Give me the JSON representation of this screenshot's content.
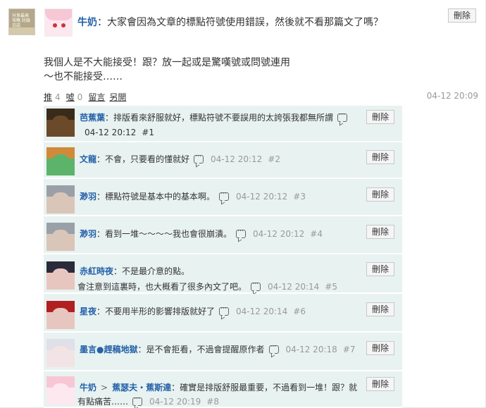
{
  "post": {
    "author": "牛奶",
    "colon": "：",
    "title": "大家會因為文章的標點符號使用錯誤，然後就不看那篇文了嗎？",
    "delete_label": "刪除",
    "avatar_text": "分享最高 攻略 討論 日誌",
    "body": [
      "我個人是不大能接受！跟？放一起或是驚嘆號或問號連用",
      "～也不能接受……"
    ],
    "actions": {
      "push_label": "推",
      "push_count": "4",
      "boo_label": "噓",
      "boo_count": "0",
      "reply_label": "留言",
      "other_label": "另開"
    },
    "time": "04-12 20:09"
  },
  "comments": [
    {
      "name": "芭蕉葉",
      "text": "：排版看來舒服就好，標點符號不要誤用的太誇張我都無所謂",
      "time": "04-12 20:12",
      "no": "#1",
      "delete_label": "刪除",
      "avatar_color": "#6b4a2a",
      "hair_color": "#3a2a1a"
    },
    {
      "name": "文龍",
      "text": "：不會，只要看的懂就好",
      "time": "04-12 20:12",
      "no": "#2",
      "delete_label": "刪除",
      "avatar_color": "#5bb46a",
      "hair_color": "#d08a3a"
    },
    {
      "name": "渺羽",
      "text": "：標點符號是基本中的基本啊。",
      "time": "04-12 20:12",
      "no": "#3",
      "delete_label": "刪除",
      "avatar_color": "#d9c6b8",
      "hair_color": "#9aa0a8"
    },
    {
      "name": "渺羽",
      "text": "：看到一堆～～～～我也會很崩潰。",
      "time": "04-12 20:12",
      "no": "#4",
      "delete_label": "刪除",
      "avatar_color": "#d9c6b8",
      "hair_color": "#9aa0a8"
    },
    {
      "name": "赤紅時夜",
      "text": "：不是最介意的點。",
      "text2": "會注意到這裏時，也大概看了很多內文了吧。",
      "time": "04-12 20:14",
      "no": "#5",
      "delete_label": "刪除",
      "avatar_color": "#e8c6c0",
      "hair_color": "#2a2a3a"
    },
    {
      "name": "星夜",
      "text": "：不要用半形的影響排版就好了",
      "time": "04-12 20:14",
      "no": "#6",
      "delete_label": "刪除",
      "avatar_color": "#e8c6c0",
      "hair_color": "#b02020"
    },
    {
      "name": "墨言●趕稿地獄",
      "text": "：是不會拒看，不過會提醒原作者",
      "time": "04-12 20:18",
      "no": "#7",
      "delete_label": "刪除",
      "avatar_color": "#f2e4e4",
      "hair_color": "#e0e0e8"
    },
    {
      "name": "牛奶",
      "arrow": ">",
      "target": "蕉瑟夫・蕉斯達",
      "text": "：確實是排版舒服最重要，不過看到一堆！跟？就",
      "text2": "有點痛苦……",
      "time": "04-12 20:19",
      "no": "#8",
      "delete_label": "刪除",
      "avatar_color": "#fde8ef",
      "hair_color": "#f7c7d6"
    }
  ],
  "colors": {
    "link": "#2461a8",
    "comment_bg": "#e8f2f1",
    "meta": "#999999"
  }
}
